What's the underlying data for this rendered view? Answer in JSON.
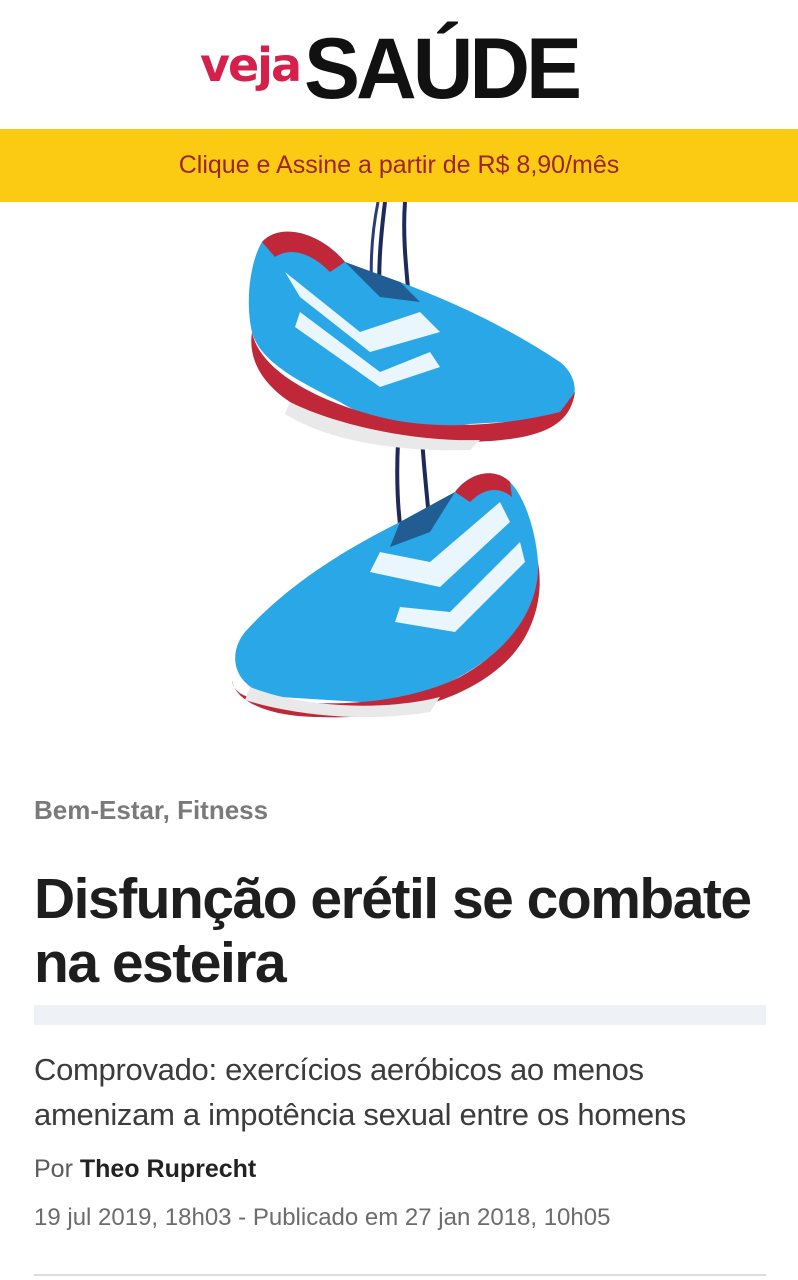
{
  "header": {
    "logo_veja": "veja",
    "logo_saude": "SAÚDE"
  },
  "banner": {
    "label": "Clique e Assine a partir de R$ 8,90/mês",
    "bg_color": "#fbcb13",
    "text_color": "#9c2424"
  },
  "hero": {
    "icon": "running-shoes-image"
  },
  "article": {
    "category_1": "Bem-Estar",
    "category_sep": ", ",
    "category_2": "Fitness",
    "headline": "Disfunção erétil se combate na esteira",
    "subtitle": "Comprovado: exercícios aeróbicos ao menos amenizam a impotência sexual entre os homens",
    "byline_prefix": "Por ",
    "author": "Theo Ruprecht",
    "dateline": "19 jul 2019, 18h03 - Publicado em 27 jan 2018, 10h05"
  },
  "colors": {
    "brand_red": "#d4204b",
    "shoe_blue": "#2aa7e6",
    "shoe_red": "#c0283a"
  }
}
